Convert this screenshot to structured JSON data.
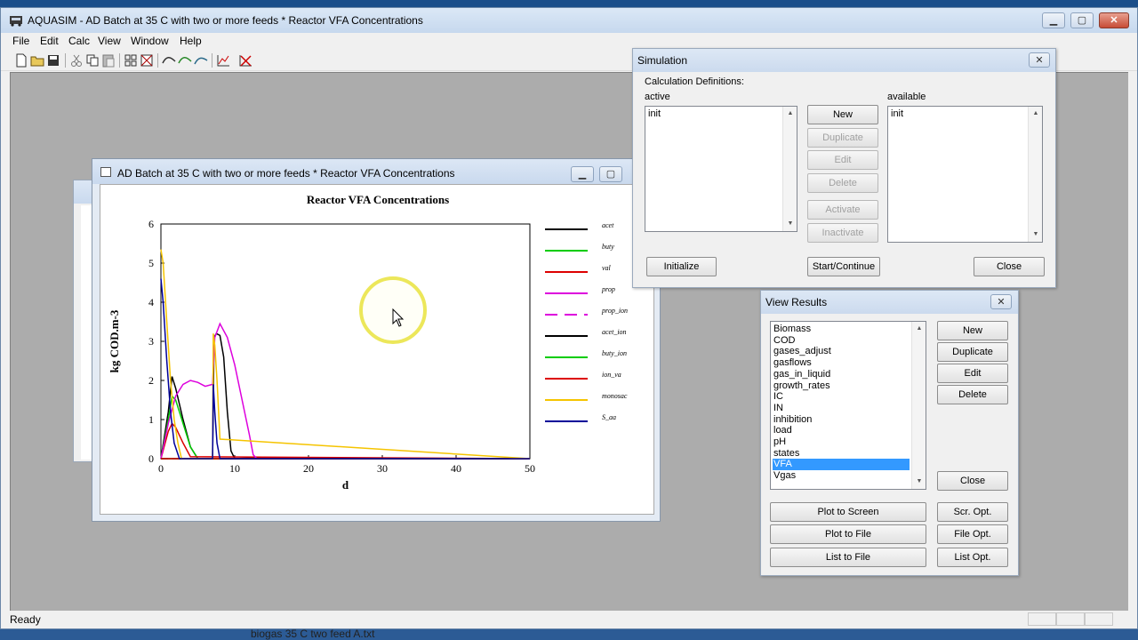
{
  "app": {
    "title": "AQUASIM - AD Batch at 35 C with two or more feeds * Reactor VFA Concentrations",
    "menu": [
      "File",
      "Edit",
      "Calc",
      "View",
      "Window",
      "Help"
    ],
    "status": "Ready",
    "caption_buttons": {
      "minimize": "▁",
      "maximize": "▢",
      "close": "✕"
    }
  },
  "plot_window": {
    "title": "AD Batch at 35 C with two or more feeds * Reactor VFA Concentrations"
  },
  "chart_data": {
    "type": "line",
    "title": "Reactor VFA Concentrations",
    "xlabel": "d",
    "ylabel": "kg COD.m-3",
    "xlim": [
      0,
      50
    ],
    "ylim": [
      0,
      6
    ],
    "xticks": [
      "0",
      "10",
      "20",
      "30",
      "40",
      "50"
    ],
    "yticks": [
      "0",
      "1",
      "2",
      "3",
      "4",
      "5",
      "6"
    ],
    "legend_position": "right",
    "series": [
      {
        "name": "acet",
        "color": "#000000",
        "style": "solid",
        "x": [
          0,
          1,
          1.5,
          2,
          3,
          4,
          5,
          7,
          7.2,
          7.5,
          8,
          8.5,
          9,
          9.5,
          10,
          12,
          50
        ],
        "y": [
          0,
          1.2,
          2.1,
          1.8,
          1.0,
          0.3,
          0,
          0,
          3.1,
          3.2,
          3.15,
          2.6,
          1.2,
          0.2,
          0,
          0.02,
          0
        ]
      },
      {
        "name": "buty",
        "color": "#00cc00",
        "style": "solid",
        "x": [
          0,
          1,
          1.5,
          2,
          3,
          4,
          5,
          50
        ],
        "y": [
          0,
          1.0,
          1.6,
          1.5,
          0.9,
          0.3,
          0,
          0
        ]
      },
      {
        "name": "val",
        "color": "#dd0000",
        "style": "solid",
        "x": [
          0,
          1,
          1.5,
          2,
          3,
          4,
          50
        ],
        "y": [
          0,
          0.7,
          0.9,
          0.8,
          0.4,
          0.05,
          0
        ]
      },
      {
        "name": "prop",
        "color": "#dd00dd",
        "style": "solid",
        "x": [
          0,
          1,
          2,
          3,
          4,
          5,
          6,
          7,
          7.3,
          8,
          9,
          10,
          11,
          12,
          12.5,
          13,
          50
        ],
        "y": [
          0,
          0.9,
          1.6,
          1.9,
          2.0,
          1.95,
          1.85,
          1.9,
          3.1,
          3.45,
          3.1,
          2.4,
          1.5,
          0.6,
          0.1,
          0,
          0
        ]
      },
      {
        "name": "prop_ion",
        "color": "#dd00dd",
        "style": "dashed",
        "x": [
          0,
          50
        ],
        "y": [
          0,
          0
        ]
      },
      {
        "name": "acet_ion",
        "color": "#000000",
        "style": "solid",
        "x": [
          0,
          50
        ],
        "y": [
          0,
          0
        ]
      },
      {
        "name": "buty_ion",
        "color": "#00cc00",
        "style": "solid",
        "x": [
          0,
          50
        ],
        "y": [
          0,
          0
        ]
      },
      {
        "name": "ion_va",
        "color": "#dd0000",
        "style": "solid",
        "x": [
          0,
          50
        ],
        "y": [
          0,
          0
        ]
      },
      {
        "name": "monosac",
        "color": "#f5c400",
        "style": "solid",
        "x": [
          0,
          0.3,
          0.8,
          1.3,
          1.8,
          2.3,
          2.8,
          7,
          7.1,
          7.3,
          7.6,
          8,
          50
        ],
        "y": [
          5.35,
          5.0,
          3.5,
          2.0,
          1.0,
          0.4,
          0,
          0,
          3.2,
          2.9,
          2.0,
          0.5,
          0
        ]
      },
      {
        "name": "S_aa",
        "color": "#000099",
        "style": "solid",
        "x": [
          0,
          0.3,
          0.8,
          1.3,
          1.8,
          2.5,
          7,
          7.1,
          7.3,
          7.6,
          8,
          50
        ],
        "y": [
          4.6,
          4.0,
          2.5,
          1.2,
          0.4,
          0,
          0,
          1.9,
          1.2,
          0.4,
          0,
          0
        ]
      }
    ]
  },
  "simulation": {
    "title": "Simulation",
    "calc_defs_label": "Calculation Definitions:",
    "active_label": "active",
    "available_label": "available",
    "active_items": [
      "init"
    ],
    "available_items": [
      "init"
    ],
    "buttons": {
      "new": "New",
      "duplicate": "Duplicate",
      "edit": "Edit",
      "delete": "Delete",
      "activate": "Activate",
      "inactivate": "Inactivate",
      "initialize": "Initialize",
      "start": "Start/Continue",
      "close": "Close"
    }
  },
  "view_results": {
    "title": "View Results",
    "items": [
      "Biomass",
      "COD",
      "gases_adjust",
      "gasflows",
      "gas_in_liquid",
      "growth_rates",
      "IC",
      "IN",
      "inhibition",
      "load",
      "pH",
      "states",
      "VFA",
      "Vgas"
    ],
    "selected": "VFA",
    "buttons": {
      "new": "New",
      "duplicate": "Duplicate",
      "edit": "Edit",
      "delete": "Delete",
      "close": "Close",
      "plot_screen": "Plot to Screen",
      "plot_file": "Plot to File",
      "list_file": "List to File",
      "scr_opt": "Scr. Opt.",
      "file_opt": "File Opt.",
      "list_opt": "List Opt."
    }
  },
  "taskbar": {
    "file_text": "biogas 35 C two feed A.txt"
  }
}
